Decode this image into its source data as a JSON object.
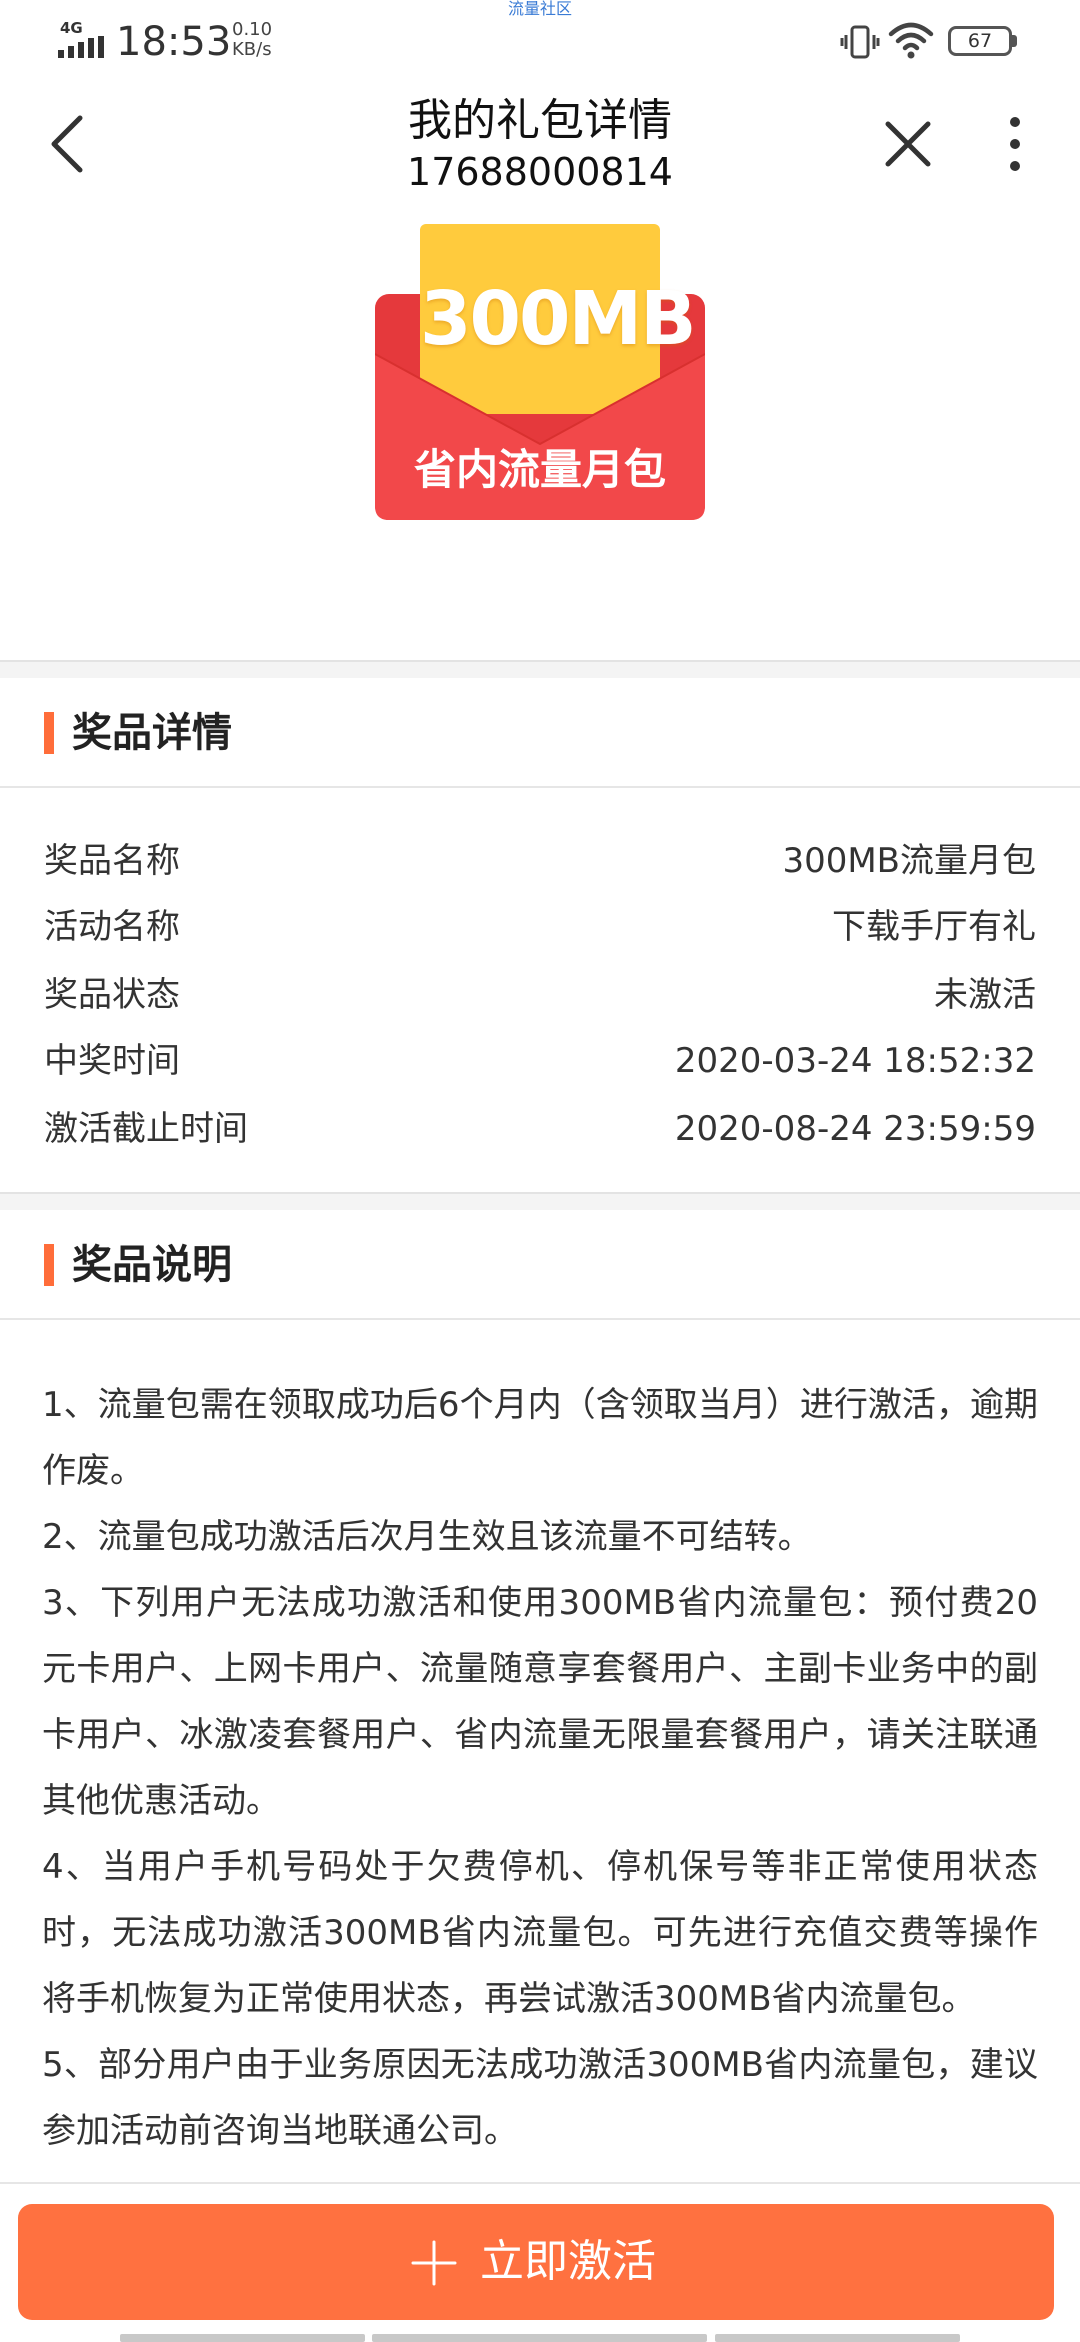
{
  "status_bar": {
    "network": "4G",
    "time": "18:53",
    "speed_value": "0.10",
    "speed_unit": "KB/s",
    "center_label": "流量社区",
    "battery": "67"
  },
  "title_bar": {
    "title": "我的礼包详情",
    "subtitle": "17688000814"
  },
  "hero": {
    "card_text": "300MB",
    "envelope_label": "省内流量月包"
  },
  "colors": {
    "accent": "#ff6d3a",
    "button": "#ff7140",
    "envelope_red": "#e5393c",
    "envelope_yellow": "#ffcb3d"
  },
  "prize_details": {
    "section_title": "奖品详情",
    "rows": [
      {
        "label": "奖品名称",
        "value": "300MB流量月包"
      },
      {
        "label": "活动名称",
        "value": "下载手厅有礼"
      },
      {
        "label": "奖品状态",
        "value": "未激活"
      },
      {
        "label": "中奖时间",
        "value": "2020-03-24 18:52:32"
      },
      {
        "label": "激活截止时间",
        "value": "2020-08-24 23:59:59"
      }
    ]
  },
  "prize_description": {
    "section_title": "奖品说明",
    "items": [
      "1、流量包需在领取成功后6个月内（含领取当月）进行激活，逾期作废。",
      "2、流量包成功激活后次月生效且该流量不可结转。",
      "3、下列用户无法成功激活和使用300MB省内流量包：预付费20元卡用户、上网卡用户、流量随意享套餐用户、主副卡业务中的副卡用户、冰激凌套餐用户、省内流量无限量套餐用户，请关注联通其他优惠活动。",
      "4、当用户手机号码处于欠费停机、停机保号等非正常使用状态时，无法成功激活300MB省内流量包。可先进行充值交费等操作将手机恢复为正常使用状态，再尝试激活300MB省内流量包。",
      "5、部分用户由于业务原因无法成功激活300MB省内流量包，建议参加活动前咨询当地联通公司。"
    ]
  },
  "action": {
    "activate_label": "立即激活",
    "plus_icon": "plus-icon"
  }
}
